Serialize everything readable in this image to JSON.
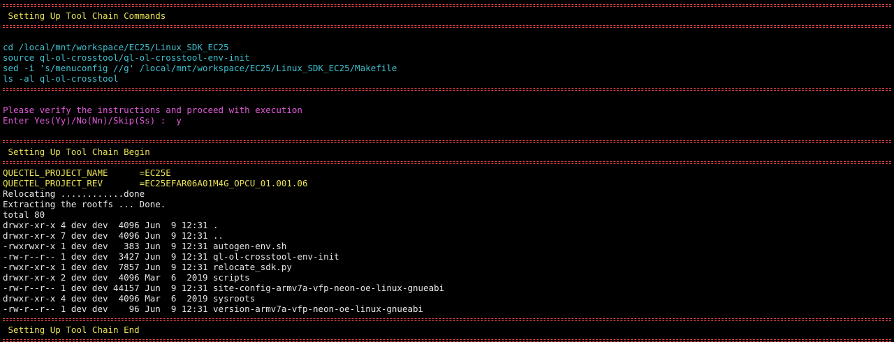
{
  "colors": {
    "background": "#000000",
    "separator_red": "#e2464b",
    "separator_cyan": "#3ab7c7",
    "heading_yellow": "#e8e055",
    "command_cyan": "#3fc1cf",
    "prompt_magenta": "#e05ad8",
    "output_white": "#e6e6e6"
  },
  "section1": {
    "title": " Setting Up Tool Chain Commands",
    "commands": [
      "cd /local/mnt/workspace/EC25/Linux_SDK_EC25",
      "source ql-ol-crosstool/ql-ol-crosstool-env-init",
      "sed -i 's/menuconfig //g' /local/mnt/workspace/EC25/Linux_SDK_EC25/Makefile",
      "ls -al ql-ol-crosstool"
    ]
  },
  "prompt": {
    "message": "Please verify the instructions and proceed with execution",
    "question": "Enter Yes(Yy)/No(Nn)/Skip(Ss) :  y"
  },
  "section2": {
    "title": " Setting Up Tool Chain Begin",
    "project": [
      "QUECTEL_PROJECT_NAME      =EC25E",
      "QUECTEL_PROJECT_REV       =EC25EFAR06A01M4G_OPCU_01.001.06"
    ],
    "output": [
      "Relocating ............done",
      "Extracting the rootfs ... Done.",
      "total 80",
      "drwxr-xr-x 4 dev dev  4096 Jun  9 12:31 .",
      "drwxr-xr-x 7 dev dev  4096 Jun  9 12:31 ..",
      "-rwxrwxr-x 1 dev dev   383 Jun  9 12:31 autogen-env.sh",
      "-rw-r--r-- 1 dev dev  3427 Jun  9 12:31 ql-ol-crosstool-env-init",
      "-rwxr-xr-x 1 dev dev  7857 Jun  9 12:31 relocate_sdk.py",
      "drwxr-xr-x 2 dev dev  4096 Mar  6  2019 scripts",
      "-rw-r--r-- 1 dev dev 44157 Jun  9 12:31 site-config-armv7a-vfp-neon-oe-linux-gnueabi",
      "drwxr-xr-x 4 dev dev  4096 Mar  6  2019 sysroots",
      "-rw-r--r-- 1 dev dev    96 Jun  9 12:31 version-armv7a-vfp-neon-oe-linux-gnueabi"
    ]
  },
  "section3": {
    "title": " Setting Up Tool Chain End"
  }
}
